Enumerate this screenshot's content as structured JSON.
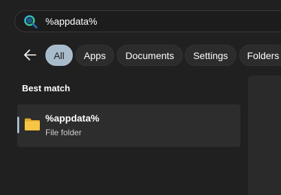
{
  "search": {
    "query": "%appdata%",
    "icon": "search-icon"
  },
  "filters": {
    "back_icon": "back-arrow-icon",
    "chips": [
      {
        "label": "All",
        "active": true
      },
      {
        "label": "Apps",
        "active": false
      },
      {
        "label": "Documents",
        "active": false
      },
      {
        "label": "Settings",
        "active": false
      },
      {
        "label": "Folders",
        "active": false
      }
    ]
  },
  "results": {
    "section_title": "Best match",
    "best_match": {
      "title": "%appdata%",
      "subtitle": "File folder",
      "icon": "folder-icon"
    }
  },
  "colors": {
    "background": "#202020",
    "accent": "#a9bccc",
    "card": "#2d2d2d",
    "folder": "#f6c545"
  }
}
